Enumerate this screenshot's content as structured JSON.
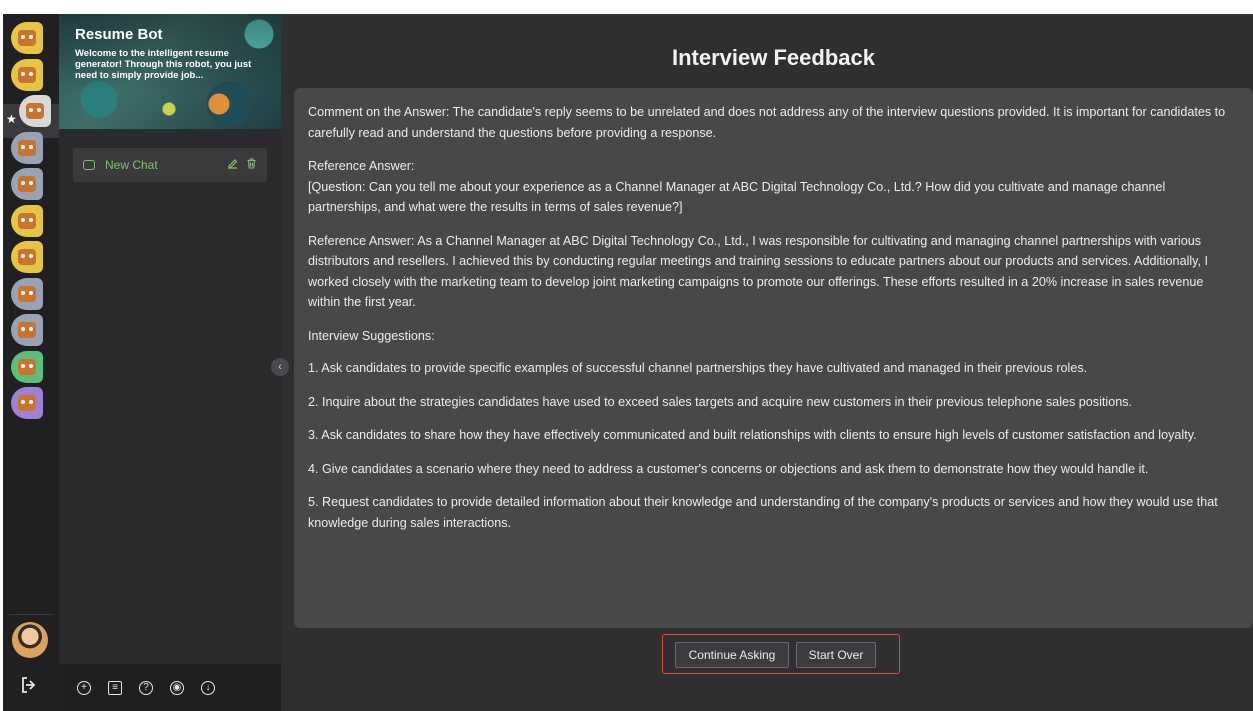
{
  "bot_rail": {
    "bots": [
      {
        "color": "#e6c545"
      },
      {
        "color": "#e6c545"
      },
      {
        "color": "#d8d8d8",
        "starred": true
      },
      {
        "color": "#9aa2b5"
      },
      {
        "color": "#9aa2b5"
      },
      {
        "color": "#e6c545"
      },
      {
        "color": "#e6c545"
      },
      {
        "color": "#9aa2b5"
      },
      {
        "color": "#9aa2b5"
      },
      {
        "color": "#5bbf7a"
      },
      {
        "color": "#a07fd6"
      }
    ],
    "star_glyph": "★"
  },
  "sidebar": {
    "bot_name": "Resume Bot",
    "bot_description": "Welcome to the intelligent resume generator! Through this robot, you just need to simply provide job...",
    "chats": [
      {
        "title": "New Chat"
      }
    ],
    "footer_icons": [
      "add-icon",
      "document-icon",
      "help-icon",
      "camera-icon",
      "download-icon"
    ]
  },
  "main": {
    "title": "Interview Feedback",
    "paragraphs": [
      "Comment on the Answer: The candidate's reply seems to be unrelated and does not address any of the interview questions provided. It is important for candidates to carefully read and understand the questions before providing a response.",
      "Reference Answer:\n[Question: Can you tell me about your experience as a Channel Manager at ABC Digital Technology Co., Ltd.? How did you cultivate and manage channel partnerships, and what were the results in terms of sales revenue?]",
      "Reference Answer: As a Channel Manager at ABC Digital Technology Co., Ltd., I was responsible for cultivating and managing channel partnerships with various distributors and resellers. I achieved this by conducting regular meetings and training sessions to educate partners about our products and services. Additionally, I worked closely with the marketing team to develop joint marketing campaigns to promote our offerings. These efforts resulted in a 20% increase in sales revenue within the first year.",
      "Interview Suggestions:",
      "1. Ask candidates to provide specific examples of successful channel partnerships they have cultivated and managed in their previous roles.",
      "2. Inquire about the strategies candidates have used to exceed sales targets and acquire new customers in their previous telephone sales positions.",
      "3. Ask candidates to share how they have effectively communicated and built relationships with clients to ensure high levels of customer satisfaction and loyalty.",
      "4. Give candidates a scenario where they need to address a customer's concerns or objections and ask them to demonstrate how they would handle it.",
      "5. Request candidates to provide detailed information about their knowledge and understanding of the company's products or services and how they would use that knowledge during sales interactions."
    ],
    "continue_label": "Continue Asking",
    "start_over_label": "Start Over"
  },
  "colors": {
    "accent_green": "#7fc16b",
    "highlight_red": "#e3463a",
    "background": "#2f2f31",
    "card": "#48484b"
  }
}
